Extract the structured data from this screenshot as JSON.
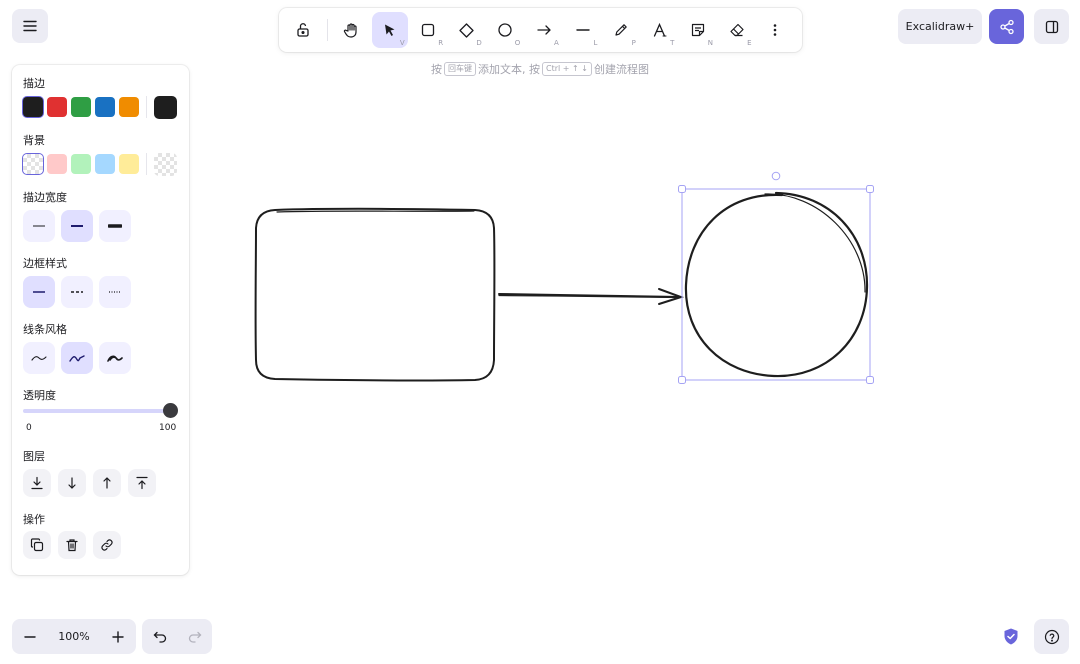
{
  "app": {
    "name": "Excalidraw"
  },
  "menu": {
    "icon": "hamburger-icon"
  },
  "toolbar": {
    "tools": [
      {
        "name": "lock",
        "icon": "unlock-icon",
        "key": ""
      },
      {
        "name": "hand",
        "icon": "hand-icon",
        "key": ""
      },
      {
        "name": "selection",
        "icon": "pointer-icon",
        "key": "V",
        "active": true
      },
      {
        "name": "rectangle",
        "icon": "rectangle-icon",
        "key": "R"
      },
      {
        "name": "diamond",
        "icon": "diamond-icon",
        "key": "D"
      },
      {
        "name": "ellipse",
        "icon": "ellipse-icon",
        "key": "O"
      },
      {
        "name": "arrow",
        "icon": "arrow-icon",
        "key": "A"
      },
      {
        "name": "line",
        "icon": "line-icon",
        "key": "L"
      },
      {
        "name": "freedraw",
        "icon": "pencil-icon",
        "key": "P"
      },
      {
        "name": "text",
        "icon": "text-icon",
        "key": "T"
      },
      {
        "name": "image",
        "icon": "note-icon",
        "key": "N"
      },
      {
        "name": "eraser",
        "icon": "eraser-icon",
        "key": "E"
      },
      {
        "name": "more",
        "icon": "more-vertical-icon",
        "key": ""
      }
    ]
  },
  "hint": {
    "part1": "按",
    "key1": "回车键",
    "part2": "添加文本, 按",
    "key2": "Ctrl + ↑ ↓",
    "part3": "创建流程图"
  },
  "topright": {
    "plus_label": "Excalidraw+",
    "share_icon": "share-icon",
    "library_icon": "sidebar-icon"
  },
  "panel": {
    "stroke_label": "描边",
    "stroke_colors": [
      "#1e1e1e",
      "#e03131",
      "#2f9e44",
      "#1971c2",
      "#f08c00"
    ],
    "stroke_current": "#1e1e1e",
    "background_label": "背景",
    "background_colors": [
      "transparent",
      "#ffc9c9",
      "#b2f2bb",
      "#a5d8ff",
      "#ffec99"
    ],
    "stroke_width_label": "描边宽度",
    "stroke_style_label": "边框样式",
    "sloppiness_label": "线条风格",
    "opacity_label": "透明度",
    "opacity_min": "0",
    "opacity_max": "100",
    "opacity_value": 100,
    "layers_label": "图层",
    "actions_label": "操作"
  },
  "footer": {
    "zoom_value": "100%",
    "zoom_out_icon": "minus-icon",
    "zoom_in_icon": "plus-icon",
    "undo_icon": "undo-icon",
    "redo_icon": "redo-icon",
    "shield_icon": "shield-check-icon",
    "help_icon": "help-icon"
  },
  "colors": {
    "accent": "#6965db",
    "selection": "#a5a3f4"
  }
}
